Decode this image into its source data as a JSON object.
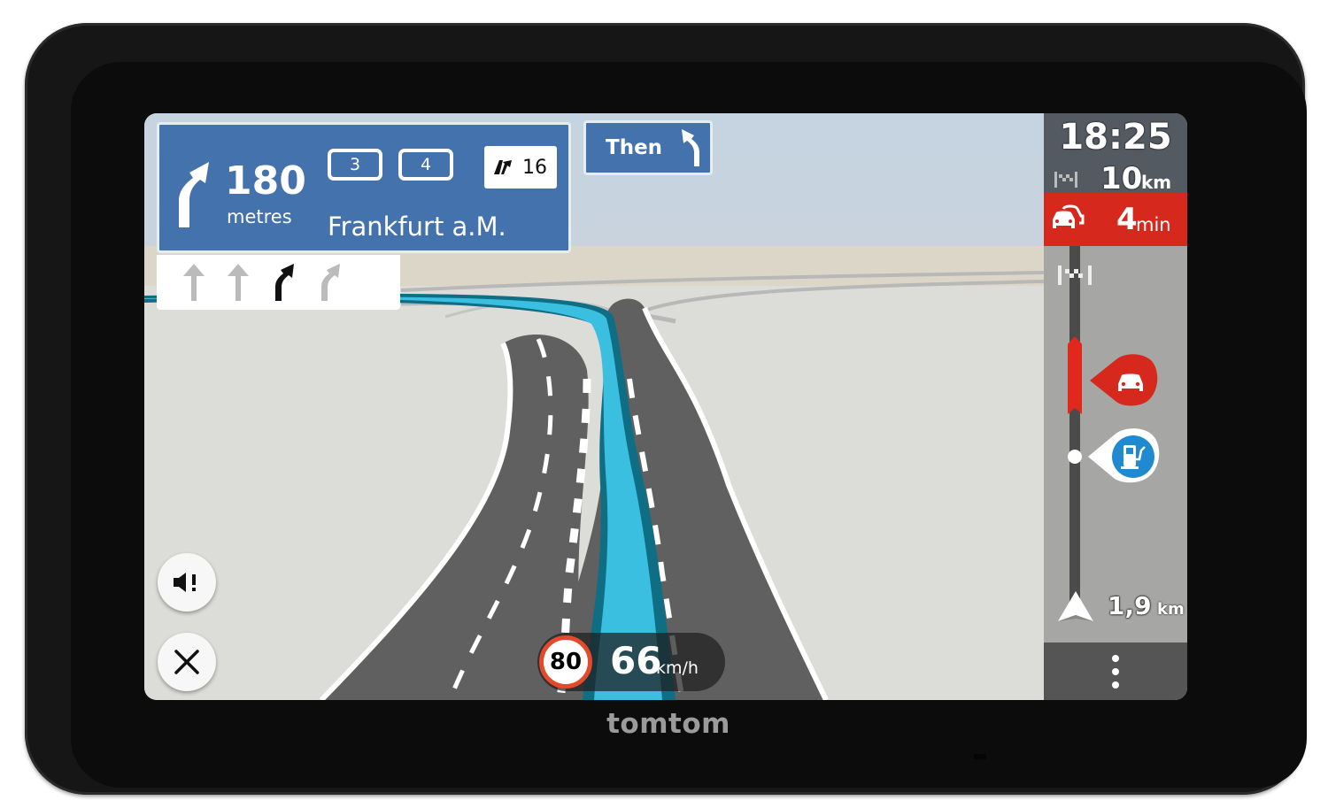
{
  "brand": "tomtom",
  "instruction": {
    "distance": "180",
    "distance_unit": "metres",
    "road_shields": [
      "3",
      "4"
    ],
    "exit_number": "16",
    "exit_icon": "motorway-exit-icon",
    "destination": "Frankfurt a.M.",
    "turn_icon": "bear-right-arrow-icon",
    "lanes": [
      {
        "icon": "straight-arrow-icon",
        "active": false
      },
      {
        "icon": "straight-arrow-icon",
        "active": false
      },
      {
        "icon": "bear-right-arrow-icon",
        "active": true
      },
      {
        "icon": "bear-right-arrow-icon",
        "active": false
      }
    ]
  },
  "next_instruction": {
    "label": "Then",
    "icon": "bear-left-arrow-icon"
  },
  "speed": {
    "limit": "80",
    "current": "66",
    "unit": "km/h"
  },
  "buttons": {
    "sound_icon": "speaker-alert-icon",
    "close_icon": "close-icon",
    "menu_icon": "more-vertical-icon"
  },
  "route_bar": {
    "eta": "18:25",
    "remaining_distance": "10",
    "remaining_unit": "km",
    "traffic_delay": "4",
    "traffic_delay_unit": "min",
    "next_poi_distance": "1,9",
    "next_poi_unit": "km",
    "colors": {
      "traffic": "#d6281c",
      "fuel": "#1f8ad0",
      "route": "#3bbfe0"
    },
    "events": [
      {
        "type": "traffic-jam",
        "icon": "car-icon"
      },
      {
        "type": "fuel-station",
        "icon": "fuel-pump-icon"
      }
    ]
  }
}
